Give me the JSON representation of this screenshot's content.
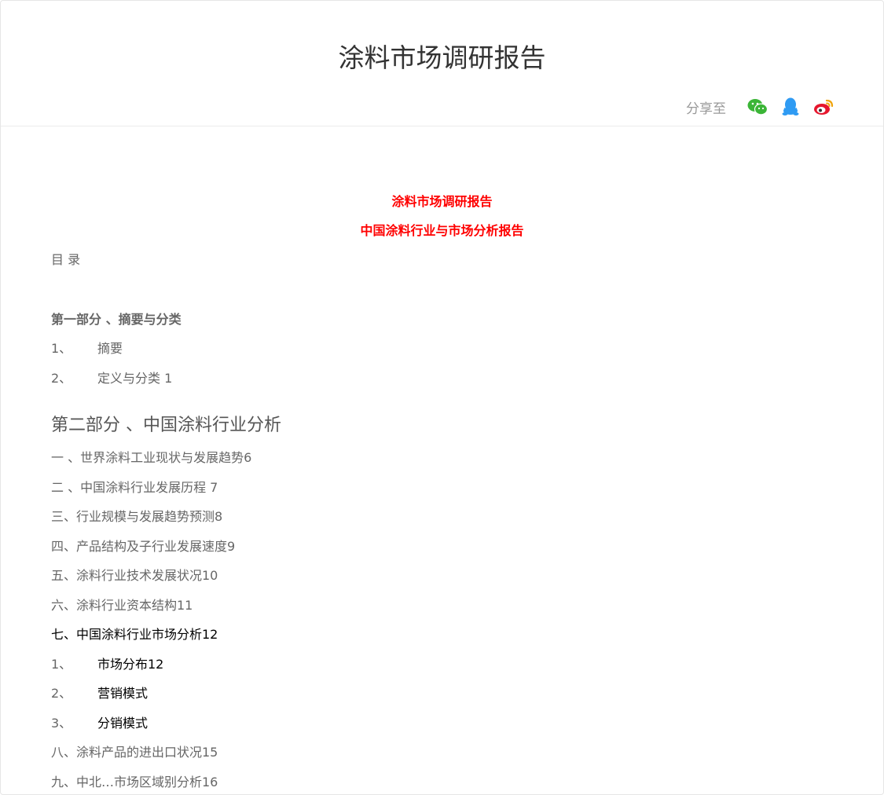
{
  "header": {
    "title": "涂料市场调研报告",
    "share_label": "分享至",
    "share_icons": [
      "wechat-icon",
      "qq-icon",
      "weibo-icon"
    ],
    "colors": {
      "wechat": "#3bb537",
      "qq": "#2f9bf3",
      "weibo": "#e6162d"
    }
  },
  "doc": {
    "red_title_1": "涂料市场调研报告",
    "red_title_2": "中国涂料行业与市场分析报告",
    "toc_heading": "目 录",
    "part1_heading": "第一部分 、摘要与分类",
    "part1_items": [
      {
        "num": "1、",
        "text": "摘要"
      },
      {
        "num": "2、",
        "text": "定义与分类 1"
      }
    ],
    "part2_heading": "第二部分 、中国涂料行业分析",
    "part2_items": [
      "一 、世界涂料工业现状与发展趋势6",
      "二 、中国涂料行业发展历程 7",
      "三、行业规模与发展趋势预测8",
      "四、产品结构及子行业发展速度9",
      "五、涂料行业技术发展状况10",
      "六、涂料行业资本结构11",
      "七、中国涂料行业市场分析12"
    ],
    "section7_items": [
      {
        "num": "1、",
        "text": "市场分布12"
      },
      {
        "num": "2、",
        "text": "营销模式"
      },
      {
        "num": "3、",
        "text": "分销模式"
      }
    ],
    "item8": "八、涂料产品的进出口状况15",
    "item9_partial": "九、中北…市场区域别分析16"
  }
}
